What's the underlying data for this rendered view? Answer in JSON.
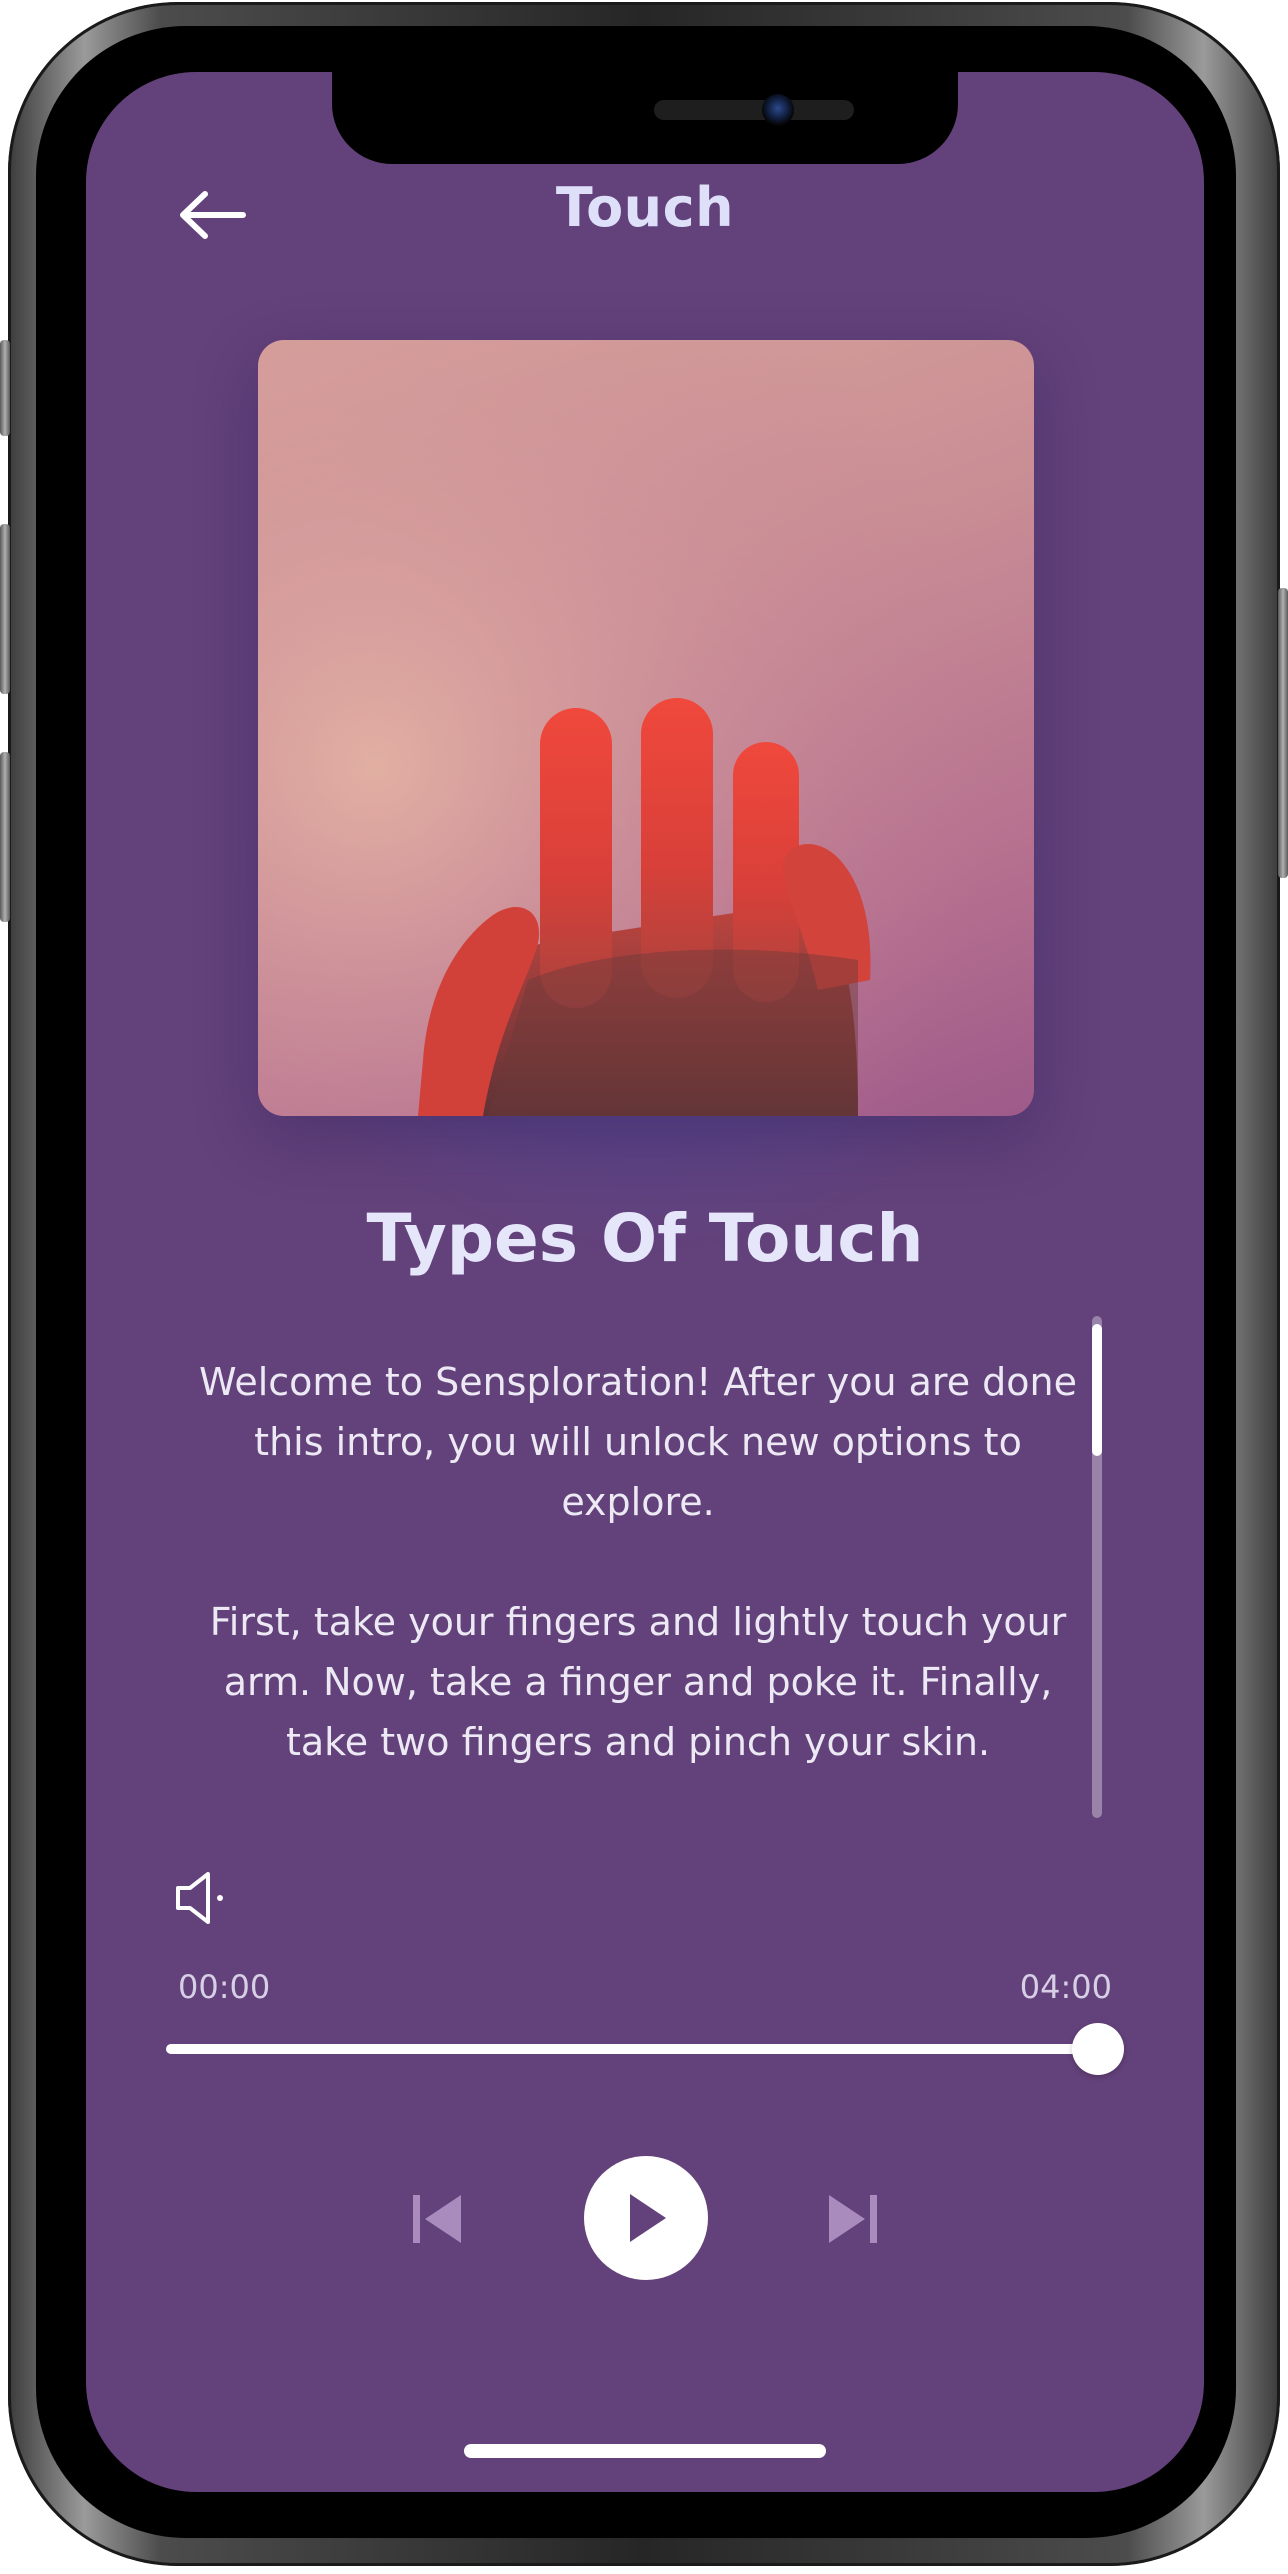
{
  "header": {
    "title": "Touch"
  },
  "main": {
    "heading": "Types Of Touch",
    "description": [
      "Welcome to Sensploration! After you are done this intro, you will unlock new options to explore.",
      "First, take your fingers and lightly touch your arm. Now, take a finger and poke it. Finally, take two fingers and pinch your skin."
    ],
    "artwork_subject": "raised hand lit in red against a pink background"
  },
  "player": {
    "current_time": "00:00",
    "total_time": "04:00",
    "progress_fraction": 1.0,
    "is_playing": false
  },
  "icons": {
    "back": "arrow-left-icon",
    "volume": "speaker-icon",
    "previous": "skip-previous-icon",
    "play": "play-icon",
    "next": "skip-next-icon"
  },
  "colors": {
    "background": "#63417a",
    "glow": "#4454a0",
    "title_text": "#dde0f8",
    "accent": "#ffffff"
  }
}
